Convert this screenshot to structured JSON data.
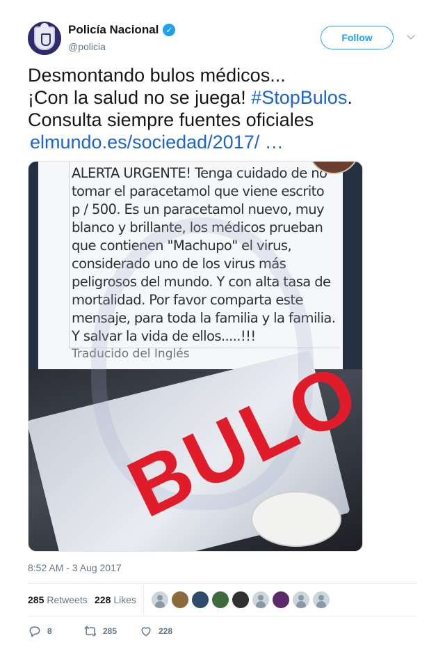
{
  "header": {
    "display_name": "Policía Nacional",
    "handle": "@policia",
    "verified_label": "✓",
    "follow_label": "Follow"
  },
  "tweet": {
    "line1": "Desmontando bulos médicos...",
    "line2_text": "¡Con la salud no se juega! ",
    "hashtag": "#StopBulos",
    "line2_end": ".",
    "line3": "Consulta siempre fuentes oficiales",
    "link": "elmundo.es/sociedad/2017/ …"
  },
  "media": {
    "alert_lines": [
      "ALERTA URGENTE! Tenga cuidado de no",
      "tomar el paracetamol que viene escrito",
      "p / 500. Es un paracetamol nuevo, muy",
      "blanco y brillante, los médicos prueban",
      "que contienen \"Machupo\" el virus,",
      "considerado uno de los virus más",
      "peligrosos del mundo. Y con alta tasa de",
      "mortalidad. Por favor comparta este",
      "mensaje, para toda la familia y la familia.",
      "Y salvar la vida de ellos.....!!!"
    ],
    "translated_label": "Traducido del Inglés",
    "stamp": "BULO"
  },
  "timestamp": "8:52 AM - 3 Aug 2017",
  "stats": {
    "retweets_count": "285",
    "retweets_label": "Retweets",
    "likes_count": "228",
    "likes_label": "Likes"
  },
  "likers": [
    {
      "color": "#ccd6dd",
      "type": "default"
    },
    {
      "color": "#8a6a3a",
      "type": "photo"
    },
    {
      "color": "#2c4a6a",
      "type": "photo"
    },
    {
      "color": "#3d6b3d",
      "type": "photo"
    },
    {
      "color": "#303030",
      "type": "photo"
    },
    {
      "color": "#ccd6dd",
      "type": "default"
    },
    {
      "color": "#5a2a6a",
      "type": "photo"
    },
    {
      "color": "#ccd6dd",
      "type": "default"
    },
    {
      "color": "#ccd6dd",
      "type": "default"
    }
  ],
  "actions": {
    "reply_count": "8",
    "retweet_count": "285",
    "like_count": "228"
  },
  "colors": {
    "accent": "#1da1f2",
    "link": "#1b64d0",
    "stamp_red": "#e11c2a"
  }
}
